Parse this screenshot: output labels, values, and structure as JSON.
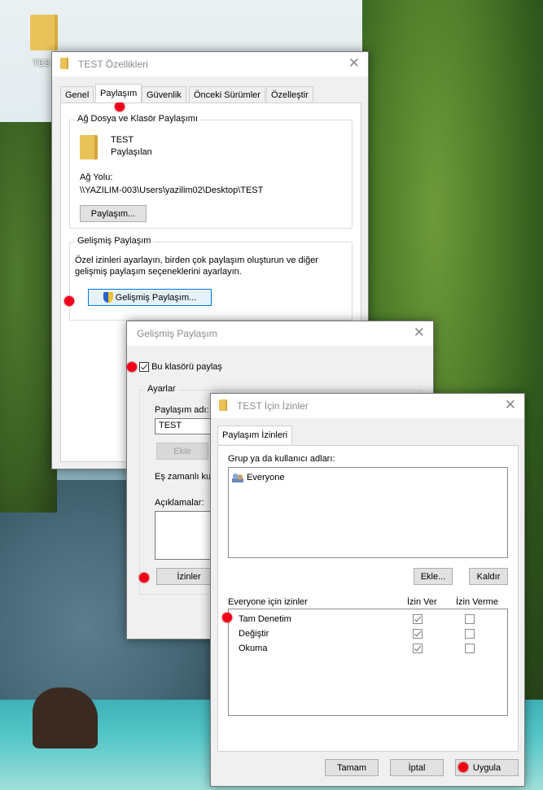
{
  "desktop": {
    "icon_label": "TES"
  },
  "props": {
    "title": "TEST Özellikleri",
    "tabs": [
      "Genel",
      "Paylaşım",
      "Güvenlik",
      "Önceki Sürümler",
      "Özelleştir"
    ],
    "active_tab": "Paylaşım",
    "net_group_label": "Ağ Dosya ve Klasör Paylaşımı",
    "folder_name": "TEST",
    "folder_status": "Paylaşılan",
    "path_label": "Ağ Yolu:",
    "path_value": "\\\\YAZILIM-003\\Users\\yazilim02\\Desktop\\TEST",
    "share_button": "Paylaşım...",
    "adv_group_label": "Gelişmiş Paylaşım",
    "adv_desc_line1": "Özel izinleri ayarlayın, birden çok paylaşım oluşturun ve diğer",
    "adv_desc_line2": "gelişmiş paylaşım seçeneklerini ayarlayın.",
    "adv_button": "Gelişmiş Paylaşım..."
  },
  "advanced": {
    "title": "Gelişmiş Paylaşım",
    "share_checkbox_label": "Bu klasörü paylaş",
    "share_checked": true,
    "settings_label": "Ayarlar",
    "share_name_label": "Paylaşım adı:",
    "share_name_value": "TEST",
    "add_button": "Ekle",
    "concurrent_label": "Eş zamanlı ku",
    "comments_label": "Açıklamalar:",
    "permissions_button": "İzinler"
  },
  "perm": {
    "title": "TEST İçin İzinler",
    "tab": "Paylaşım İzinleri",
    "group_label": "Grup ya da kullanıcı adları:",
    "users": [
      "Everyone"
    ],
    "add_button": "Ekle...",
    "remove_button": "Kaldır",
    "perm_for_label": "Everyone için izinler",
    "col_allow": "İzin Ver",
    "col_deny": "İzin Verme",
    "rows": [
      {
        "name": "Tam Denetim",
        "allow": true,
        "deny": false
      },
      {
        "name": "Değiştir",
        "allow": true,
        "deny": false
      },
      {
        "name": "Okuma",
        "allow": true,
        "deny": false
      }
    ],
    "ok_button": "Tamam",
    "cancel_button": "İptal",
    "apply_button": "Uygula"
  },
  "colors": {
    "marker": "#f2001a",
    "focus_border": "#0078d7",
    "folder": "#e9c35a"
  }
}
